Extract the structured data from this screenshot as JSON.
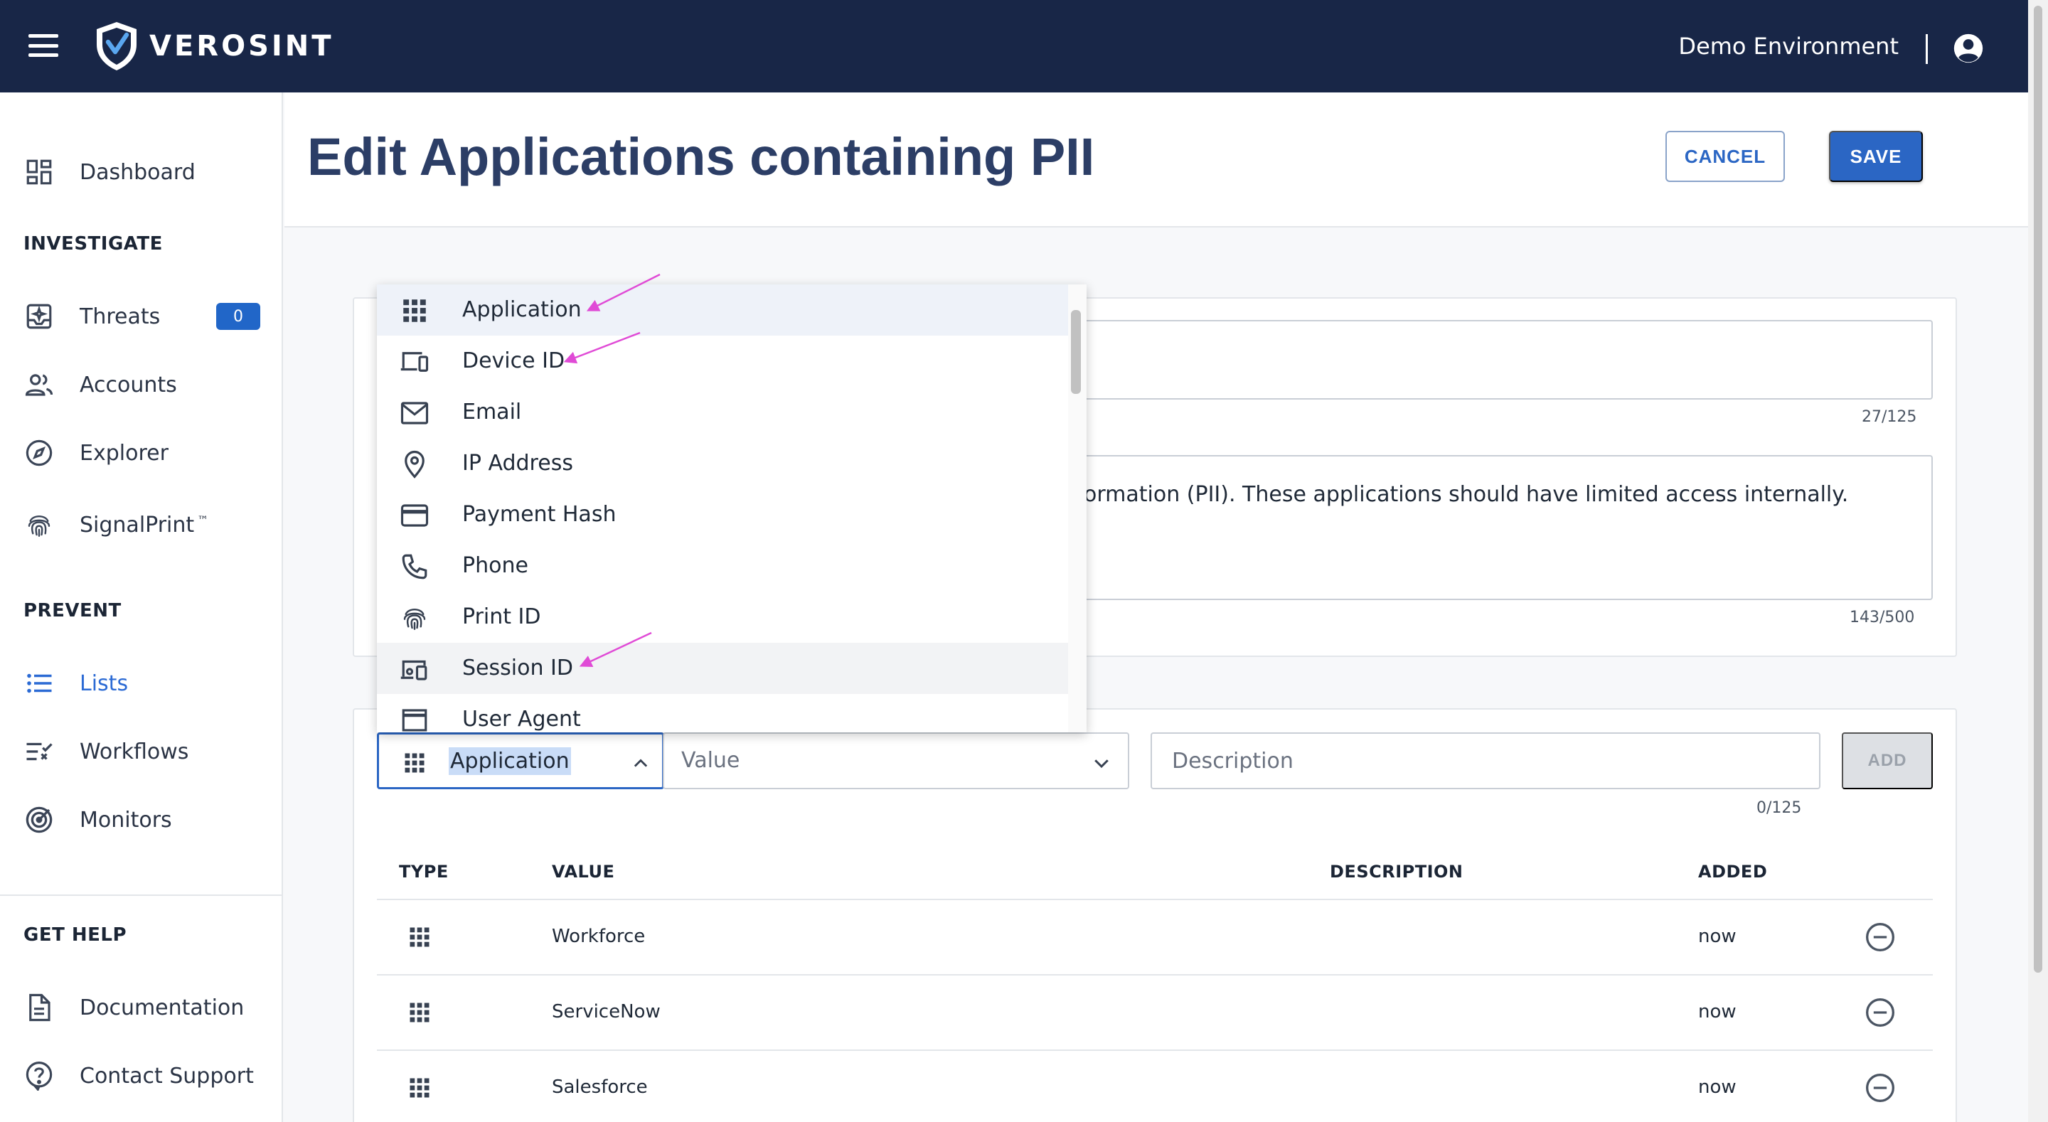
{
  "topbar": {
    "brand": "VEROSINT",
    "environment": "Demo Environment"
  },
  "sidebar": {
    "dashboard": "Dashboard",
    "investigate_header": "INVESTIGATE",
    "threats": "Threats",
    "threats_count": "0",
    "accounts": "Accounts",
    "explorer": "Explorer",
    "signalprint": "SignalPrint",
    "signalprint_tm": "™",
    "prevent_header": "PREVENT",
    "lists": "Lists",
    "workflows": "Workflows",
    "monitors": "Monitors",
    "help_header": "GET HELP",
    "documentation": "Documentation",
    "contact_support": "Contact Support"
  },
  "header": {
    "title": "Edit Applications containing PII",
    "cancel_label": "CANCEL",
    "save_label": "SAVE"
  },
  "details": {
    "name_count": "27/125",
    "description_visible": "ormation (PII). These applications should have limited access internally.",
    "description_count": "143/500"
  },
  "entry": {
    "type_selected": "Application",
    "value_placeholder": "Value",
    "description_placeholder": "Description",
    "description_count": "0/125",
    "add_label": "ADD"
  },
  "dropdown": {
    "options": [
      "Application",
      "Device ID",
      "Email",
      "IP Address",
      "Payment Hash",
      "Phone",
      "Print ID",
      "Session ID",
      "User Agent"
    ]
  },
  "table": {
    "headers": {
      "type": "TYPE",
      "value": "VALUE",
      "description": "DESCRIPTION",
      "added": "ADDED"
    },
    "rows": [
      {
        "value": "Workforce",
        "added": "now"
      },
      {
        "value": "ServiceNow",
        "added": "now"
      },
      {
        "value": "Salesforce",
        "added": "now"
      }
    ]
  },
  "icons": {
    "application": "grid-icon",
    "device_id": "devices-icon",
    "email": "mail-icon",
    "ip_address": "location-pin-icon",
    "payment_hash": "credit-card-icon",
    "phone": "phone-icon",
    "print_id": "fingerprint-icon",
    "session_id": "session-devices-icon",
    "user_agent": "browser-window-icon"
  },
  "colors": {
    "topbar": "#182647",
    "accent": "#2b66c4",
    "title": "#2c3e66",
    "annotation_arrow": "#e04bd6"
  }
}
